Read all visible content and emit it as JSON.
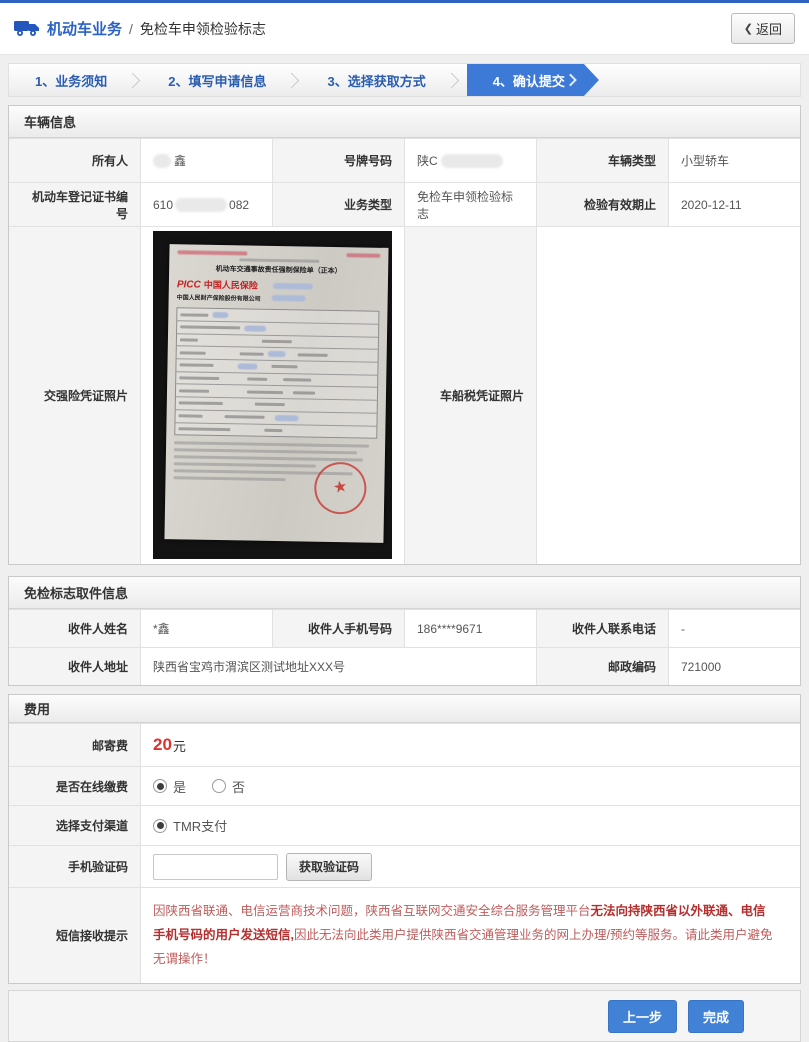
{
  "header": {
    "title_primary": "机动车业务",
    "divider": "/",
    "title_secondary": "免检车申领检验标志",
    "back_chevron": "❮",
    "back_button": "返回"
  },
  "steps": {
    "step1": "1、业务须知",
    "step2": "2、填写申请信息",
    "step3": "3、选择获取方式",
    "step4": "4、确认提交"
  },
  "vehicle": {
    "section_title": "车辆信息",
    "owner_label": "所有人",
    "owner_value": "鑫",
    "plate_label": "号牌号码",
    "plate_value": "陕C",
    "vehicle_type_label": "车辆类型",
    "vehicle_type_value": "小型轿车",
    "reg_cert_label": "机动车登记证书编号",
    "reg_cert_prefix": "610",
    "reg_cert_suffix": "082",
    "biz_type_label": "业务类型",
    "biz_type_value": "免检车申领检验标志",
    "valid_until_label": "检验有效期止",
    "valid_until_value": "2020-12-11",
    "insurance_photo_label": "交强险凭证照片",
    "tax_photo_label": "车船税凭证照片"
  },
  "insurance_doc": {
    "title": "机动车交通事故责任强制保险单（正本）",
    "brand": "PICC",
    "brand_cn": "中国人民保险",
    "company": "中国人民财产保险股份有限公司",
    "stamp_star": "★"
  },
  "pickup": {
    "section_title": "免检标志取件信息",
    "name_label": "收件人姓名",
    "name_value": "*鑫",
    "mobile_label": "收件人手机号码",
    "mobile_value": "186****9671",
    "phone_label": "收件人联系电话",
    "phone_value": "-",
    "address_label": "收件人地址",
    "address_value": "陕西省宝鸡市渭滨区测试地址XXX号",
    "zip_label": "邮政编码",
    "zip_value": "721000"
  },
  "fee": {
    "section_title": "费用",
    "postage_label": "邮寄费",
    "postage_amount": "20",
    "postage_unit": "元",
    "online_pay_label": "是否在线缴费",
    "online_yes": "是",
    "online_no": "否",
    "channel_label": "选择支付渠道",
    "channel_value": "TMR支付",
    "sms_code_label": "手机验证码",
    "sms_code_button": "获取验证码",
    "sms_tip_label": "短信接收提示",
    "sms_tip_part1": "因陕西省联通、电信运营商技术问题，陕西省互联网交通安全综合服务管理平台",
    "sms_tip_part2": "无法向持陕西省以外联通、电信手机号码的用户发送短信,",
    "sms_tip_part3": "因此无法向此类用户提供陕西省交通管理业务的网上办理/预约等服务。请此类用户避免无谓操作！"
  },
  "footer": {
    "prev_button": "上一步",
    "done_button": "完成"
  },
  "colors": {
    "accent_blue": "#2a62c4",
    "active_tab_blue": "#3d7ad8",
    "button_blue": "#4282d6",
    "price_red": "#e03131",
    "notice_red": "#c05b5b"
  }
}
